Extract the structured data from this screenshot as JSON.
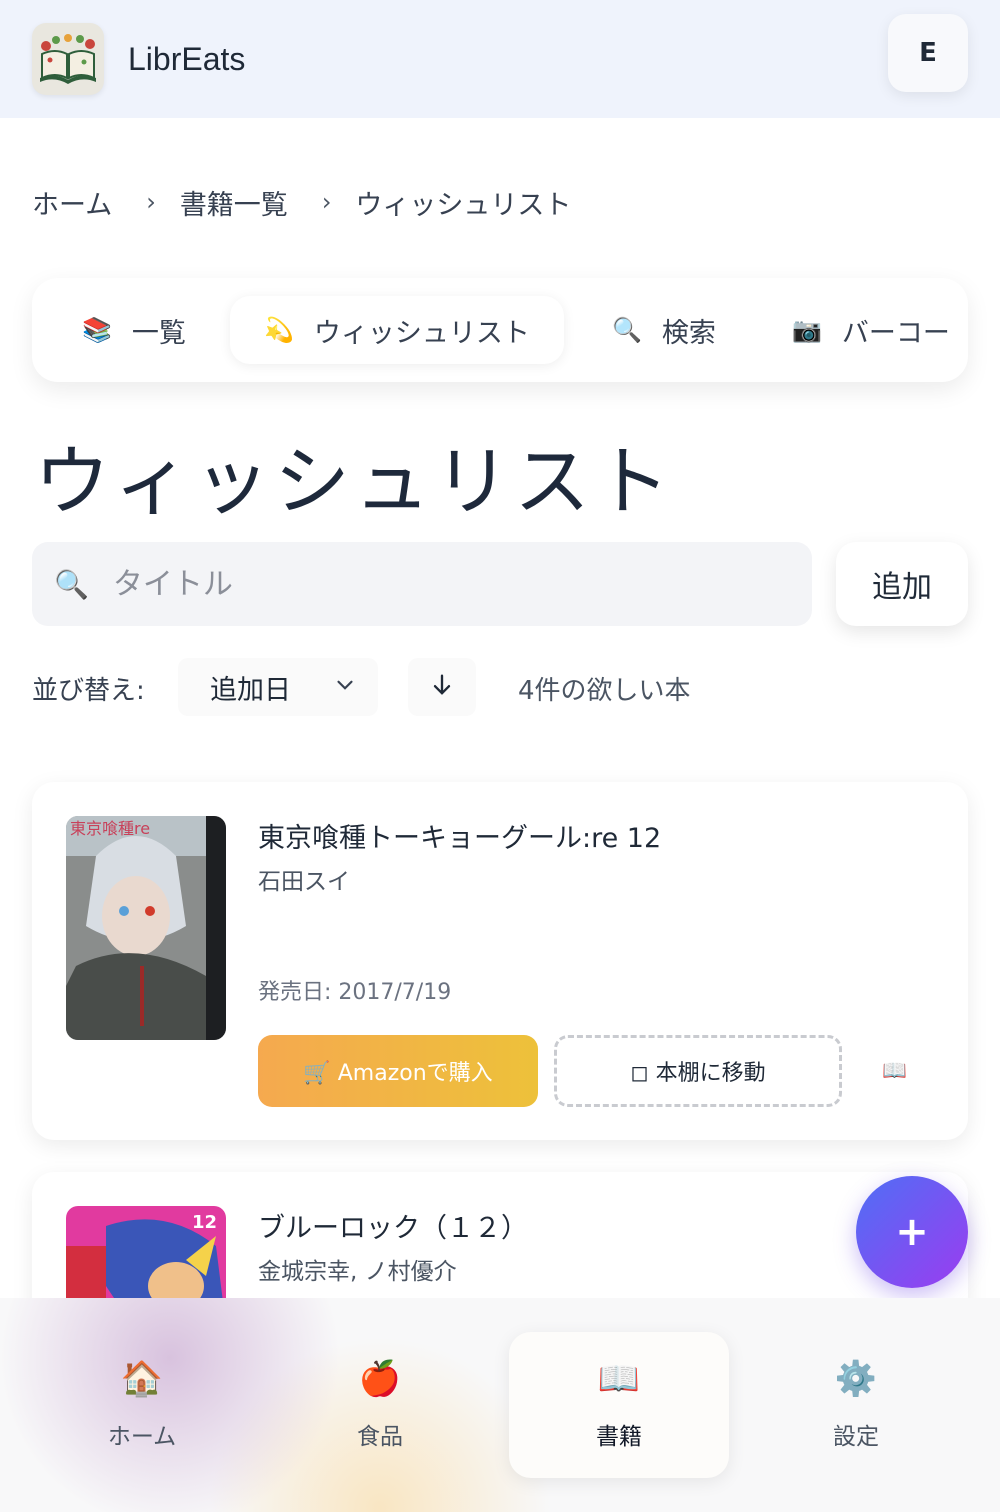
{
  "header": {
    "app_title": "LibrEats",
    "avatar_letter": "E",
    "logo_icon": "book-salad-logo"
  },
  "breadcrumb": {
    "items": [
      "ホーム",
      "書籍一覧",
      "ウィッシュリスト"
    ],
    "separator": "›"
  },
  "tabs": [
    {
      "icon": "📚",
      "label": "一覧",
      "active": false
    },
    {
      "icon": "💫",
      "label": "ウィッシュリスト",
      "active": true
    },
    {
      "icon": "🔍",
      "label": "検索",
      "active": false
    },
    {
      "icon": "📷",
      "label": "バーコー",
      "active": false
    }
  ],
  "page_title": "ウィッシュリスト",
  "search": {
    "icon": "🔍",
    "placeholder": "タイトル",
    "value": ""
  },
  "add_button": "追加",
  "sort": {
    "label": "並び替え:",
    "selected": "追加日",
    "direction_icon": "arrow-down-icon",
    "count_text": "4件の欲しい本"
  },
  "books": [
    {
      "title": "東京喰種トーキョーグール:re 12",
      "author": "石田スイ",
      "release": "発売日: 2017/7/19",
      "amazon_label": "🛒 Amazonで購入",
      "shelf_label": "◻ 本棚に移動",
      "book_icon": "📖"
    },
    {
      "title": "ブルーロック（１２）",
      "author": "金城宗幸, ノ村優介"
    }
  ],
  "fab_label": "+",
  "bottom_nav": [
    {
      "icon": "🏠",
      "label": "ホーム",
      "active": false
    },
    {
      "icon": "🍎",
      "label": "食品",
      "active": false
    },
    {
      "icon": "📖",
      "label": "書籍",
      "active": true
    },
    {
      "icon": "⚙️",
      "label": "設定",
      "active": false
    }
  ],
  "colors": {
    "header_bg": "#eff3fc",
    "amazon_start": "#f5a94f",
    "amazon_end": "#edc13a",
    "fab_start": "#4f6ff5",
    "fab_end": "#9b3cf0"
  }
}
